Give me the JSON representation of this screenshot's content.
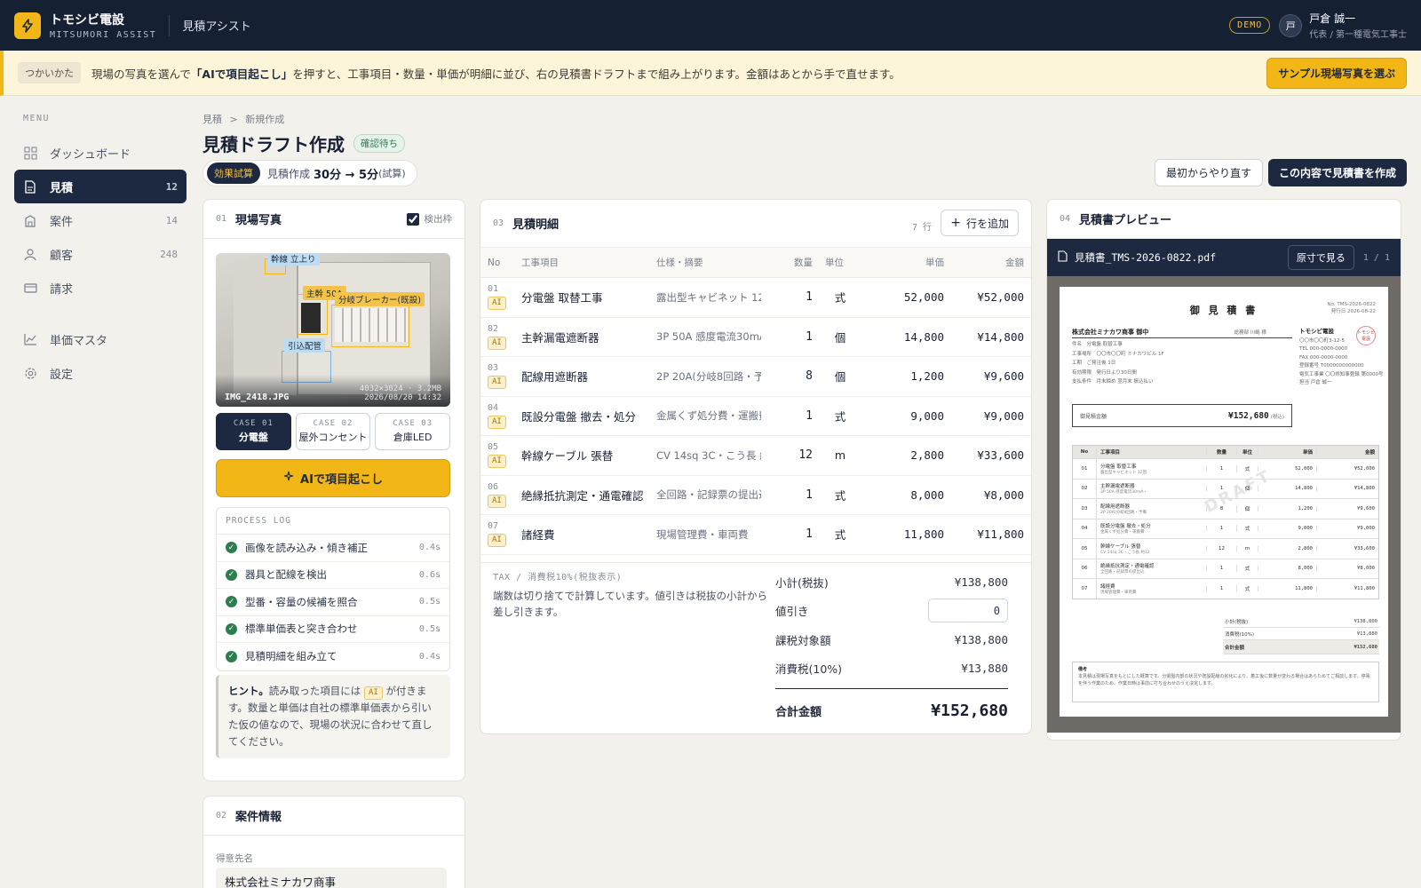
{
  "header": {
    "brand_name": "トモシビ電設",
    "brand_sub": "MITSUMORI ASSIST",
    "app_name": "見積アシスト",
    "demo_badge": "DEMO",
    "user_initial": "戸",
    "user_name": "戸倉 誠一",
    "user_role": "代表 / 第一種電気工事士"
  },
  "banner": {
    "tag": "つかいかた",
    "text_before": "現場の写真を選んで",
    "text_bold": "「AIで項目起こし」",
    "text_after": "を押すと、工事項目・数量・単価が明細に並び、右の見積書ドラフトまで組み上がります。金額はあとから手で直せます。",
    "sample_button": "サンプル現場写真を選ぶ"
  },
  "sidebar": {
    "menu_label": "MENU",
    "items": [
      {
        "label": "ダッシュボード",
        "count": "",
        "icon": "dashboard-icon"
      },
      {
        "label": "見積",
        "count": "12",
        "icon": "document-icon"
      },
      {
        "label": "案件",
        "count": "14",
        "icon": "building-icon"
      },
      {
        "label": "顧客",
        "count": "248",
        "icon": "user-icon"
      },
      {
        "label": "請求",
        "count": "",
        "icon": "card-icon"
      },
      {
        "label": "単価マスタ",
        "count": "",
        "icon": "chart-icon"
      },
      {
        "label": "設定",
        "count": "",
        "icon": "gear-icon"
      }
    ]
  },
  "page": {
    "crumb_root": "見積",
    "crumb_sep": ">",
    "crumb_current": "新規作成",
    "title": "見積ドラフト作成",
    "status": "確認待ち",
    "effect_tag": "効果試算",
    "effect_prefix": "見積作成",
    "effect_value": "30分 → 5分",
    "effect_suffix": "(試算)",
    "restart_button": "最初からやり直す",
    "create_button": "この内容で見積書を作成"
  },
  "photo_card": {
    "num": "01",
    "title": "現場写真",
    "checkbox_label": "検出枠",
    "checkbox_checked": true,
    "detections": [
      "幹線 立上り",
      "主幹 50A",
      "分岐ブレーカー(既設)",
      "引込配管"
    ],
    "file_name": "IMG_2418.JPG",
    "file_meta": "4032×3024 · 3.2MB",
    "file_date": "2026/08/20 14:32",
    "cases": [
      {
        "code": "CASE 01",
        "name": "分電盤"
      },
      {
        "code": "CASE 02",
        "name": "屋外コンセント"
      },
      {
        "code": "CASE 03",
        "name": "倉庫LED"
      }
    ],
    "ai_button": "AIで項目起こし",
    "log_title": "PROCESS LOG",
    "log": [
      {
        "text": "画像を読み込み・傾き補正",
        "time": "0.4s"
      },
      {
        "text": "器具と配線を検出",
        "time": "0.6s"
      },
      {
        "text": "型番・容量の候補を照合",
        "time": "0.5s"
      },
      {
        "text": "標準単価表と突き合わせ",
        "time": "0.5s"
      },
      {
        "text": "見積明細を組み立て",
        "time": "0.4s"
      }
    ],
    "hint_bold": "ヒント。",
    "hint_before": "読み取った項目には",
    "hint_chip": "AI",
    "hint_after": "が付きます。数量と単価は自社の標準単価表から引いた仮の値なので、現場の状況に合わせて直してください。"
  },
  "case_card": {
    "num": "02",
    "title": "案件情報",
    "client_label": "得意先名",
    "client_value": "株式会社ミナカワ商事"
  },
  "estimate": {
    "num": "03",
    "title": "見積明細",
    "row_count": "7 行",
    "add_row": "行を追加",
    "columns": [
      "No",
      "工事項目",
      "仕様・摘要",
      "数量",
      "単位",
      "単価",
      "金額"
    ],
    "ai_chip": "AI",
    "rows": [
      {
        "no": "01",
        "item": "分電盤 取替工事",
        "spec": "露出型キャビネット 12回",
        "qty": "1",
        "unit": "式",
        "price": "52,000",
        "amount": "¥52,000"
      },
      {
        "no": "02",
        "item": "主幹漏電遮断器",
        "spec": "3P 50A 感度電流30mA・",
        "qty": "1",
        "unit": "個",
        "price": "14,800",
        "amount": "¥14,800"
      },
      {
        "no": "03",
        "item": "配線用遮断器",
        "spec": "2P 20A(分岐8回路・予備",
        "qty": "8",
        "unit": "個",
        "price": "1,200",
        "amount": "¥9,600"
      },
      {
        "no": "04",
        "item": "既設分電盤 撤去・処分",
        "spec": "金属くず処分費・運搬費",
        "qty": "1",
        "unit": "式",
        "price": "9,000",
        "amount": "¥9,000"
      },
      {
        "no": "05",
        "item": "幹線ケーブル 張替",
        "spec": "CV 14sq 3C・こう長 約12",
        "qty": "12",
        "unit": "m",
        "price": "2,800",
        "amount": "¥33,600"
      },
      {
        "no": "06",
        "item": "絶縁抵抗測定・通電確認",
        "spec": "全回路・記録票の提出込",
        "qty": "1",
        "unit": "式",
        "price": "8,000",
        "amount": "¥8,000"
      },
      {
        "no": "07",
        "item": "諸経費",
        "spec": "現場管理費・車両費",
        "qty": "1",
        "unit": "式",
        "price": "11,800",
        "amount": "¥11,800"
      }
    ],
    "tax_label": "TAX / 消費税10%(税抜表示)",
    "tax_note": "端数は切り捨てで計算しています。値引きは税抜の小計から差し引きます。",
    "subtotal_label": "小計(税抜)",
    "subtotal": "¥138,800",
    "discount_label": "値引き",
    "discount": "0",
    "taxable_label": "課税対象額",
    "taxable": "¥138,800",
    "tax_row_label": "消費税(10%)",
    "tax": "¥13,880",
    "total_label": "合計金額",
    "total": "¥152,680"
  },
  "preview": {
    "num": "04",
    "title": "見積書プレビュー",
    "file": "見積書_TMS-2026-0822.pdf",
    "view_button": "原寸で見る",
    "page": "1 / 1",
    "doc_title": "御 見 積 書",
    "doc_no": "No. TMS-2026-0822",
    "doc_date": "発行日 2026-08-22",
    "doc_client": "株式会社ミナカワ商事 御中",
    "doc_client_person": "総務部 川嶋 様",
    "doc_meta": [
      "件名　分電盤 取替工事",
      "工事場所　〇〇市〇〇町 ミナカワビル 1F",
      "工期　ご発注後 1日",
      "有効期限　発行日より30日間",
      "支払条件　月末締め 翌月末 振込払い"
    ],
    "doc_issuer": "トモシビ電設",
    "doc_issuer_lines": [
      "〇〇市〇〇町3-12-5",
      "TEL 000-0000-0000",
      "FAX 000-0000-0000",
      "登録番号 T0000000000000",
      "電気工事業 〇〇県知事登録 第0000号",
      "担当 戸倉 誠一"
    ],
    "doc_seal": "トモシビ 電設",
    "doc_amount_label": "御見積金額",
    "doc_amount": "¥152,680",
    "doc_amount_tax": "(税込)",
    "doc_columns": [
      "No",
      "工事項目",
      "数量",
      "単位",
      "単価",
      "金額"
    ],
    "doc_subtotal_label": "小計(税抜)",
    "doc_subtotal": "¥138,800",
    "doc_tax_label": "消費税(10%)",
    "doc_tax": "¥13,880",
    "doc_total_label": "合計金額",
    "doc_total": "¥152,680",
    "doc_note_title": "備考",
    "doc_note": "本見積は現場写真をもとにした概算です。分電盤内部の状況や既設配線の劣化により、着工後に数量が変わる場合はあらためてご相談します。停電を伴う作業のため、作業日時は事前に打ち合わせのうえ決定します。",
    "watermark": "DRAFT"
  },
  "colors": {
    "navy": "#162033",
    "accent_yellow": "#f3b617",
    "success_green": "#2e7d4f"
  }
}
